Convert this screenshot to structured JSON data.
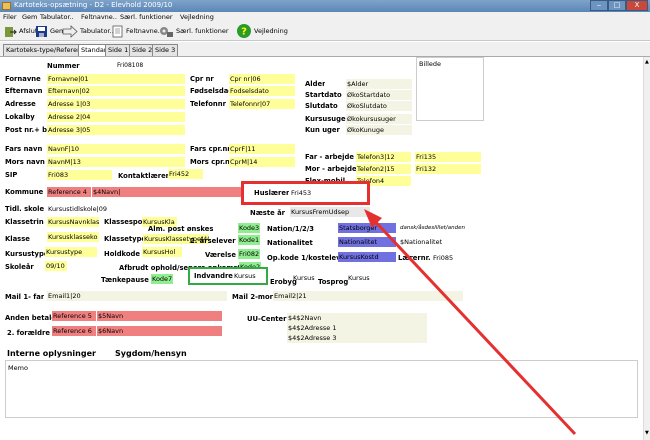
{
  "window": {
    "title": "Kartoteks-opsætning - D2 - Elevhold 2009/10",
    "minimize": "‒",
    "maximize": "□",
    "close": "X"
  },
  "menu": [
    "Filer",
    "Gem",
    "Tabulator..",
    "Feltnavne..",
    "Særl. funktioner",
    "Vejledning"
  ],
  "toolbar": [
    {
      "label": "Afslut",
      "icon": "exit-icon"
    },
    {
      "label": "Gem",
      "icon": "save-icon"
    },
    {
      "label": "Tabulator..",
      "icon": "arrow-right-icon"
    },
    {
      "label": "Feltnavne..",
      "icon": "document-icon"
    },
    {
      "label": "Særl. funktioner",
      "icon": "tools-icon"
    },
    {
      "label": "Vejledning",
      "icon": "help-icon"
    }
  ],
  "tabs": [
    "Kartoteks-type/Referencer",
    "Standard",
    "Side 1",
    "Side 2",
    "Side 3"
  ],
  "form": {
    "nummer_label": "Nummer",
    "nummer_value": "Fri08108",
    "billede_label": "Billede",
    "fornavne_label": "Fornavne",
    "fornavne_value": "Fornavne|01",
    "efternavn_label": "Efternavn",
    "efternavn_value": "Efternavn|02",
    "adresse_label": "Adresse",
    "adresse_value": "Adresse 1|03",
    "lokalby_label": "Lokalby",
    "lokalby_value": "Adresse 2|04",
    "postnr_label": "Post nr.+ by",
    "postnr_value": "Adresse 3|05",
    "cprnr_label": "Cpr nr",
    "cprnr_value": "Cpr nr|06",
    "foedselsdag_label": "Fødselsdag",
    "foedselsdag_value": "Fodselsdato",
    "telefonnr_label": "Telefonnr",
    "telefonnr_value": "Telefonnr|07",
    "alder_label": "Alder",
    "alder_value": "$Alder",
    "startdato_label": "Startdato",
    "startdato_value": "ØkoStartdato",
    "slutdato_label": "Slutdato",
    "slutdato_value": "ØkoSlutdato",
    "kursusuger_label": "Kursusuger",
    "kursusuger_value": "Økokursusuger",
    "kununger_label": "Kun uger",
    "kununger_value": "ØkoKunuge",
    "farsnavn_label": "Fars navn",
    "farsnavn_value": "NavnF|10",
    "morsnavn_label": "Mors navn",
    "morsnavn_value": "NavnM|13",
    "farscpr_label": "Fars cpr.nr",
    "farscpr_value": "CprF|11",
    "morscpr_label": "Mors cpr.nr",
    "morscpr_value": "CprM|14",
    "fararbejde_label": "Far - arbejde",
    "fararbejde_value": "Telefon3|12",
    "fararbejde_value2": "Fri135",
    "morarbejde_label": "Mor - arbejde",
    "morarbejde_value": "Telefon2|15",
    "morarbejde_value2": "Fri132",
    "sip_label": "SIP",
    "sip_value": "Fri083",
    "kontaktlaerer_label": "Kontaktlærer",
    "kontaktlaerer_value": "Fri452",
    "flexmobil_label": "Flex-mobil",
    "flexmobil_value": "Telefon4",
    "kommune_label": "Kommune",
    "kommune_value": "Reference 4",
    "kommune_value2": "$4Navn|",
    "huslaerer_label": "Huslærer",
    "huslaerer_value": "Fri453",
    "naesteaar_label": "Næste år",
    "naesteaar_value": "KursusFremUdsep",
    "tidlskole_label": "Tidl. skole",
    "tidlskole_value": "Kursustidlskole|09",
    "klassetrin_label": "Klassetrin",
    "klassetrin_value": "KursusNavnklass",
    "klassespor_label": "Klassespor",
    "klassespor_value": "KursusKla",
    "klasse_label": "Klasse",
    "klasse_value": "Kursusklasseko",
    "klassetype_label": "Klassetype",
    "klassetype_value": "KursusKlassetype|40",
    "kursustype_label": "Kursustype",
    "kursustype_value": "Kursustype",
    "holdkode_label": "Holdkode",
    "holdkode_value": "KursusHol",
    "skoleaar_label": "Skoleår",
    "skoleaar_value": "09/10",
    "almpost_label": "Alm. post ønskes",
    "almpost_value": "Kode3",
    "aarselever_label": "2. årselever",
    "aarselever_value": "Kode1",
    "vaerelse_label": "Værelse",
    "vaerelse_value": "Fri082",
    "afbrudt_label": "Afbrudt ophold/senere ankomst",
    "afbrudt_value": "Kode2",
    "taenkepause_label": "Tænkepause",
    "taenkepause_value": "Kode7",
    "nation_label": "Nation/1/2/3",
    "nation_value": "Statsborger",
    "nation_value2": "dansk/åsdeslillet/anden",
    "nationalitet_label": "Nationalitet",
    "nationalitet_value": "Nationalitet",
    "nationalitet_value2": "$Nationalitet",
    "opkode_label": "Op.kode 1/kostelev",
    "opkode_value": "KursusKostd",
    "laerernr_label": "Lærernr.",
    "laerernr_value": "Fri085",
    "indvandre_label": "Indvandre",
    "indvandre_value": "Kursus",
    "erobyg_label": "Erobyg",
    "erobyg_value": "Kursus",
    "tosprog_label": "Tosprog",
    "tosprog_value": "Kursus",
    "mail1_label": "Mail 1- far",
    "mail1_value": "Email1|20",
    "mail2_label": "Mail 2-mor",
    "mail2_value": "Email2|21",
    "andenbetaler_label": "Anden betaler",
    "andenbetaler_value": "Reference 5",
    "andenbetaler_value2": "$5Navn",
    "foraeldre_label": "2. forældre",
    "foraeldre_value": "Reference 6",
    "foraeldre_value2": "$6Navn",
    "uucenter_label": "UU-Center",
    "uucenter_values": [
      "$4$2Navn",
      "$4$2Adresse 1",
      "$4$2Adresse 3"
    ],
    "interne_label": "Interne oplysninger",
    "sygdom_label": "Sygdom/hensyn",
    "memo_label": "Memo"
  },
  "colors": {
    "yellow": "#ffff99",
    "red": "#f08080",
    "green": "#90ee90",
    "blue": "#7070e0",
    "highlight_red": "#e53030",
    "highlight_green": "#33aa44"
  }
}
